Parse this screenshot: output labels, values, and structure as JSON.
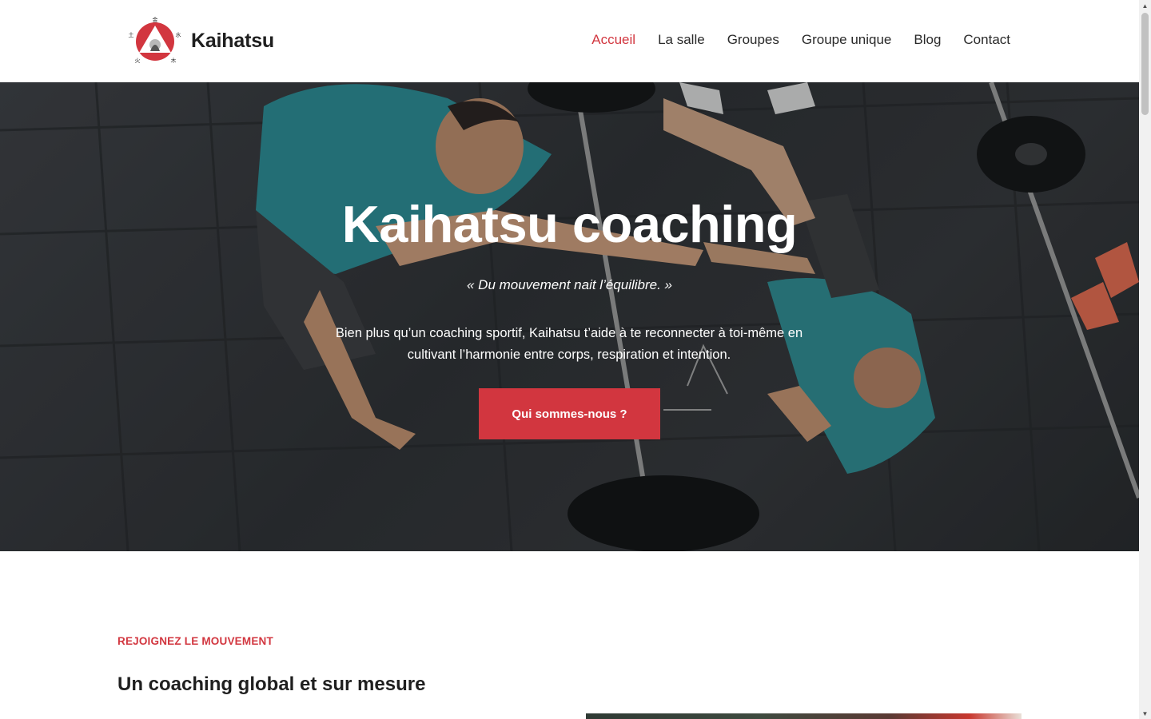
{
  "header": {
    "brand_name": "Kaihatsu",
    "nav": [
      {
        "label": "Accueil",
        "active": true
      },
      {
        "label": "La salle",
        "active": false
      },
      {
        "label": "Groupes",
        "active": false
      },
      {
        "label": "Groupe unique",
        "active": false
      },
      {
        "label": "Blog",
        "active": false
      },
      {
        "label": "Contact",
        "active": false
      }
    ]
  },
  "hero": {
    "title": "Kaihatsu coaching",
    "quote": "« Du mouvement nait l’équilibre. »",
    "description": "Bien plus qu’un coaching sportif, Kaihatsu t’aide à te reconnecter à toi-même en cultivant l’harmonie entre corps, respiration et intention.",
    "cta_label": "Qui sommes-nous ?"
  },
  "section": {
    "eyebrow": "REJOIGNEZ LE MOUVEMENT",
    "title": "Un coaching global et sur mesure"
  },
  "colors": {
    "accent": "#d2363f",
    "text_dark": "#1f1f1f",
    "background": "#ffffff"
  },
  "icons": {
    "logo": "kaihatsu-logo",
    "scroll_up": "scroll-up-arrow-icon",
    "scroll_down": "scroll-down-arrow-icon"
  }
}
